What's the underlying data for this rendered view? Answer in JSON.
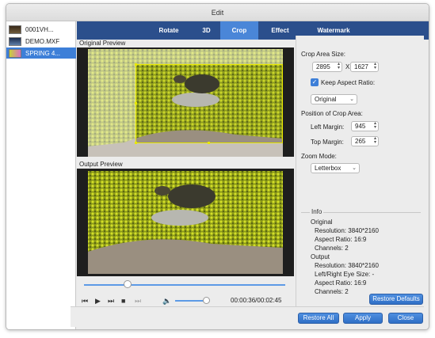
{
  "window": {
    "title": "Edit"
  },
  "files": [
    {
      "name": "0001VH...",
      "selected": false
    },
    {
      "name": "DEMO.MXF",
      "selected": false
    },
    {
      "name": "SPRING 4...",
      "selected": true
    }
  ],
  "tabs": [
    {
      "label": "Rotate",
      "active": false
    },
    {
      "label": "3D",
      "active": false
    },
    {
      "label": "Crop",
      "active": true
    },
    {
      "label": "Effect",
      "active": false
    },
    {
      "label": "Watermark",
      "active": false
    }
  ],
  "previews": {
    "original_title": "Original Preview",
    "output_title": "Output Preview"
  },
  "player": {
    "timecode": "00:00:36/00:02:45",
    "progress_fraction": 0.22,
    "volume_fraction": 0.85
  },
  "crop": {
    "area_size_label": "Crop Area Size:",
    "width": "2895",
    "times": "X",
    "height": "1627",
    "keep_aspect_label": "Keep Aspect Ratio:",
    "keep_aspect_checked": true,
    "aspect_option": "Original",
    "position_label": "Position of Crop Area:",
    "left_margin_label": "Left Margin:",
    "left_margin": "945",
    "top_margin_label": "Top Margin:",
    "top_margin": "265",
    "zoom_label": "Zoom Mode:",
    "zoom_option": "Letterbox"
  },
  "info": {
    "heading": "Info",
    "original_heading": "Original",
    "original_resolution": "Resolution: 3840*2160",
    "original_aspect": "Aspect Ratio: 16:9",
    "original_channels": "Channels: 2",
    "output_heading": "Output",
    "output_resolution": "Resolution: 3840*2160",
    "output_eye": "Left/Right Eye Size: -",
    "output_aspect": "Aspect Ratio: 16:9",
    "output_channels": "Channels: 2"
  },
  "buttons": {
    "restore_defaults": "Restore Defaults",
    "restore_all": "Restore All",
    "apply": "Apply",
    "close": "Close"
  },
  "icons": {
    "skip_back": "⏮",
    "play": "▶",
    "skip_forward": "⏭",
    "stop": "■",
    "frame": "⏭",
    "volume": "🔈"
  },
  "colors": {
    "accent": "#3d7fd8",
    "tabbar": "#2b4f8c",
    "crop_frame": "#e8e800"
  }
}
